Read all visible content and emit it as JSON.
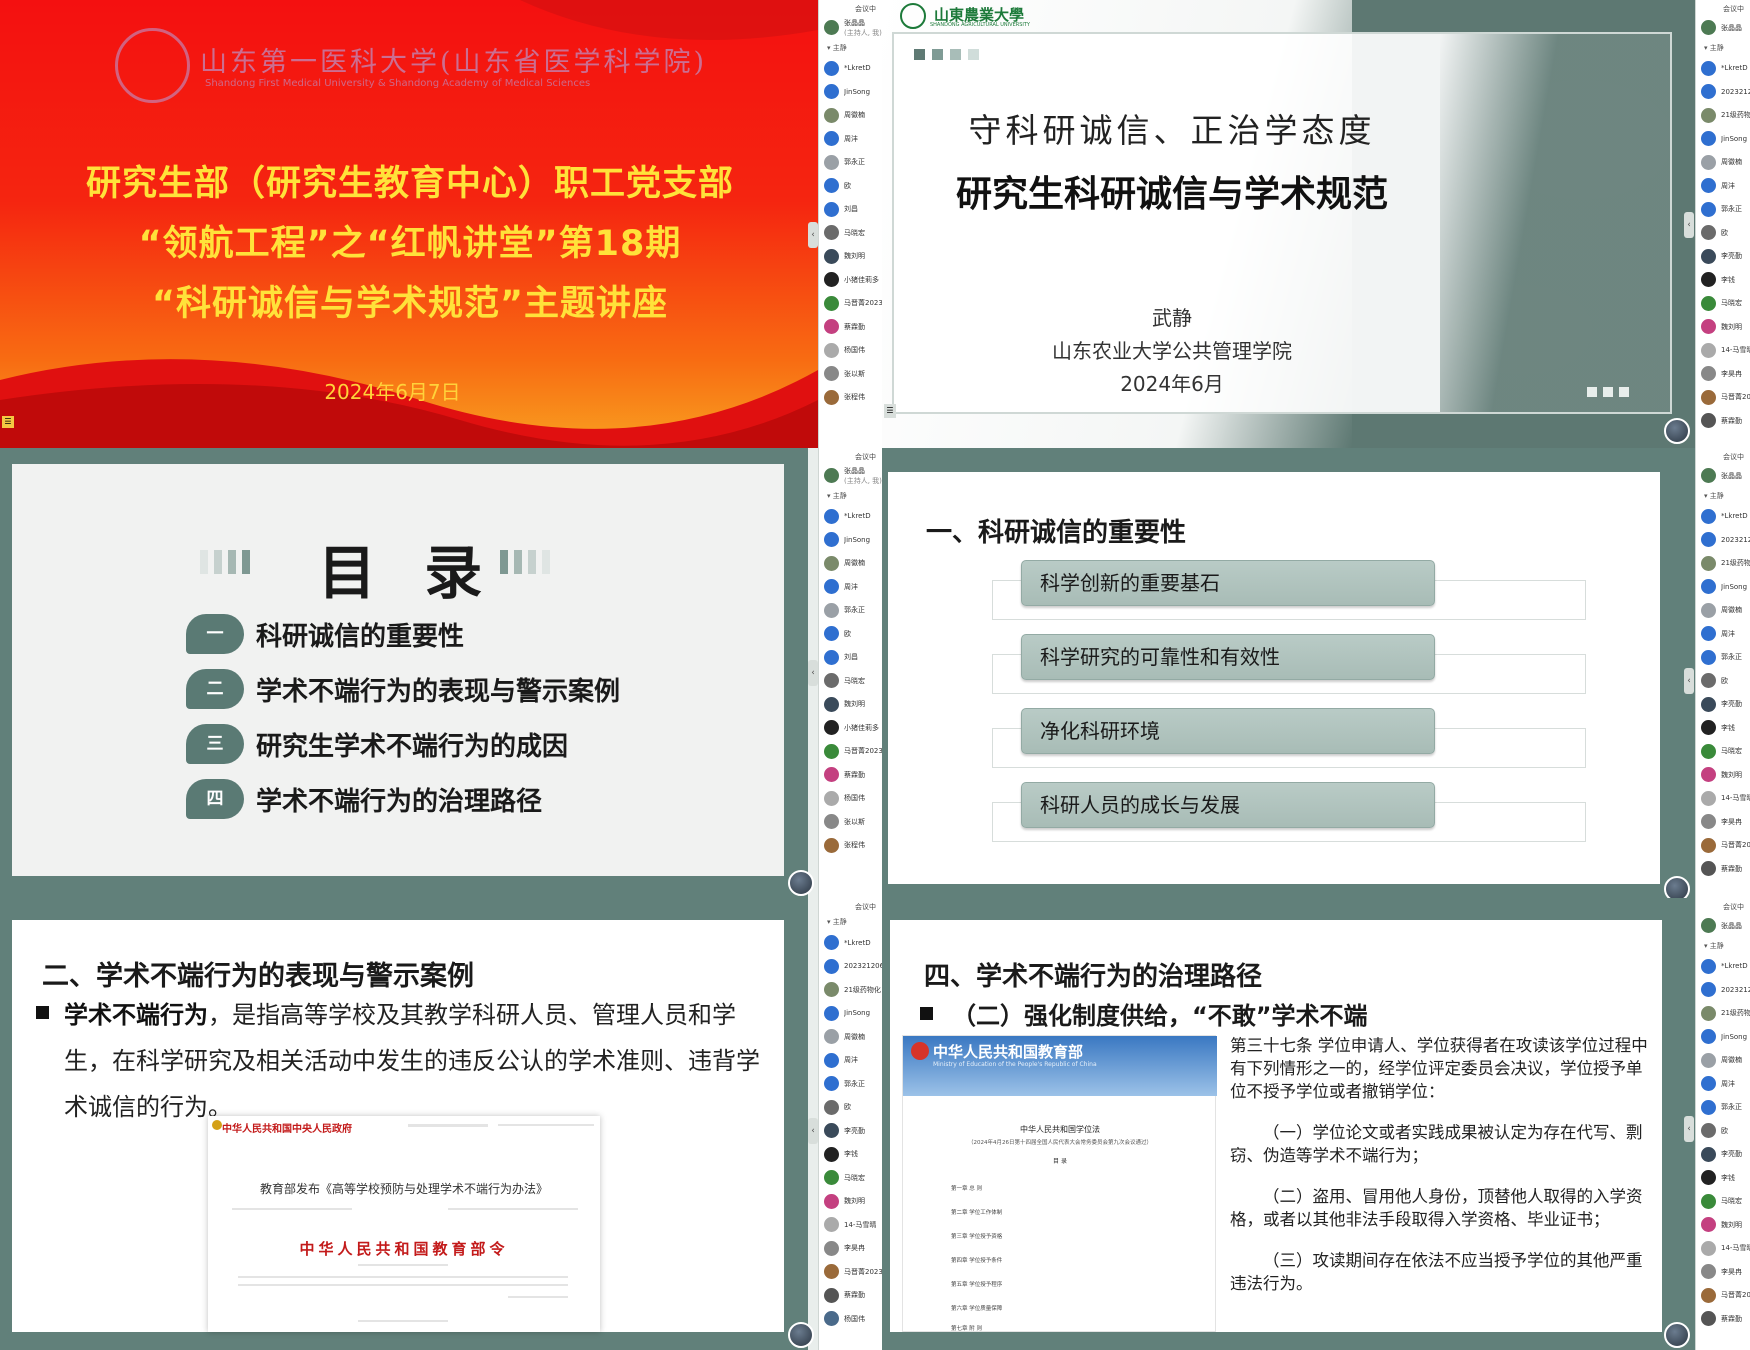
{
  "slide1": {
    "school_name": "山东第一医科大学(山东省医学科学院)",
    "school_name_en": "Shandong First Medical University & Shandong Academy of Medical Sciences",
    "line1": "研究生部（研究生教育中心）职工党支部",
    "line2": "“领航工程”之“红帆讲堂”第18期",
    "line3": "“科研诚信与学术规范”主题讲座",
    "date": "2024年6月7日"
  },
  "slide2": {
    "logo": "山東農業大學",
    "logo_en": "SHANDONG AGRICULTURAL UNIVERSITY",
    "heading": "守科研诚信、正治学态度",
    "title": "研究生科研诚信与学术规范",
    "author": "武静",
    "org": "山东农业大学公共管理学院",
    "date": "2024年6月"
  },
  "slide3": {
    "title": "目 录",
    "items": [
      {
        "num": "一",
        "text": "科研诚信的重要性"
      },
      {
        "num": "二",
        "text": "学术不端行为的表现与警示案例"
      },
      {
        "num": "三",
        "text": "研究生学术不端行为的成因"
      },
      {
        "num": "四",
        "text": "学术不端行为的治理路径"
      }
    ]
  },
  "slide4": {
    "title": "一、科研诚信的重要性",
    "items": [
      "科学创新的重要基石",
      "科学研究的可靠性和有效性",
      "净化科研环境",
      "科研人员的成长与发展"
    ]
  },
  "slide5": {
    "title": "二、学术不端行为的表现与警示案例",
    "lead": "学术不端行为",
    "text": "，是指高等学校及其教学科研人员、管理人员和学生，在科学研究及相关活动中发生的违反公认的学术准则、违背学术诚信的行为。",
    "doc_site": "中华人民共和国中央人民政府",
    "doc_title": "教育部发布《高等学校预防与处理学术不端行为办法》",
    "doc_decree": "中华人民共和国教育部令"
  },
  "slide6": {
    "title": "四、学术不端行为的治理路径",
    "subtitle": "（二）强化制度供给，“不敢”学术不端",
    "doc_band": "中华人民共和国教育部",
    "doc_band_en": "Ministry of Education of the People's Republic of China",
    "doc_title": "中华人民共和国学位法",
    "doc_sub": "（2024年4月26日第十四届全国人民代表大会常务委员会第九次会议通过）",
    "doc_toc": "目 录",
    "doc_chapters": [
      "第一章 总 则",
      "第二章 学位工作体制",
      "第三章 学位授予资格",
      "第四章 学位授予条件",
      "第五章 学位授予程序",
      "第六章 学位质量保障",
      "第七章 附 则"
    ],
    "p1": "第三十七条 学位申请人、学位获得者在攻读该学位过程中有下列情形之一的，经学位评定委员会决议，学位授予单位不授予学位或者撤销学位：",
    "p2": "（一）学位论文或者实践成果被认定为存在代写、剽窃、伪造等学术不端行为；",
    "p3": "（二）盗用、冒用他人身份，顶替他人取得的入学资格，或者以其他非法手段取得入学资格、毕业证书；",
    "p4": "（三）攻读期间存在依法不应当授予学位的其他严重违法行为。"
  },
  "sidebar": {
    "meeting_label": "会议中",
    "host": "张晶晶",
    "host_role": "(主持人, 我)",
    "section": "主静",
    "list_a": [
      "*LkretD",
      "JinSong",
      "周徽楠",
      "周沣",
      "郭永正",
      "欧",
      "刘昌",
      "马晓宏",
      "魏刘明",
      "小猪佳莉多",
      "马晋菁2023",
      "蔡霖勤",
      "杨国伟",
      "张以斯",
      "张程伟"
    ],
    "list_b": [
      "*LkretD",
      "202321206",
      "21级药物化",
      "JinSong",
      "周徽楠",
      "周沣",
      "郭永正",
      "欧",
      "李亮勤",
      "李钱",
      "马晓宏",
      "魏刘明",
      "14-马雪晴",
      "李昊冉",
      "马晋菁2023",
      "蔡霖勤",
      "杨国伟",
      "张以斯"
    ]
  }
}
